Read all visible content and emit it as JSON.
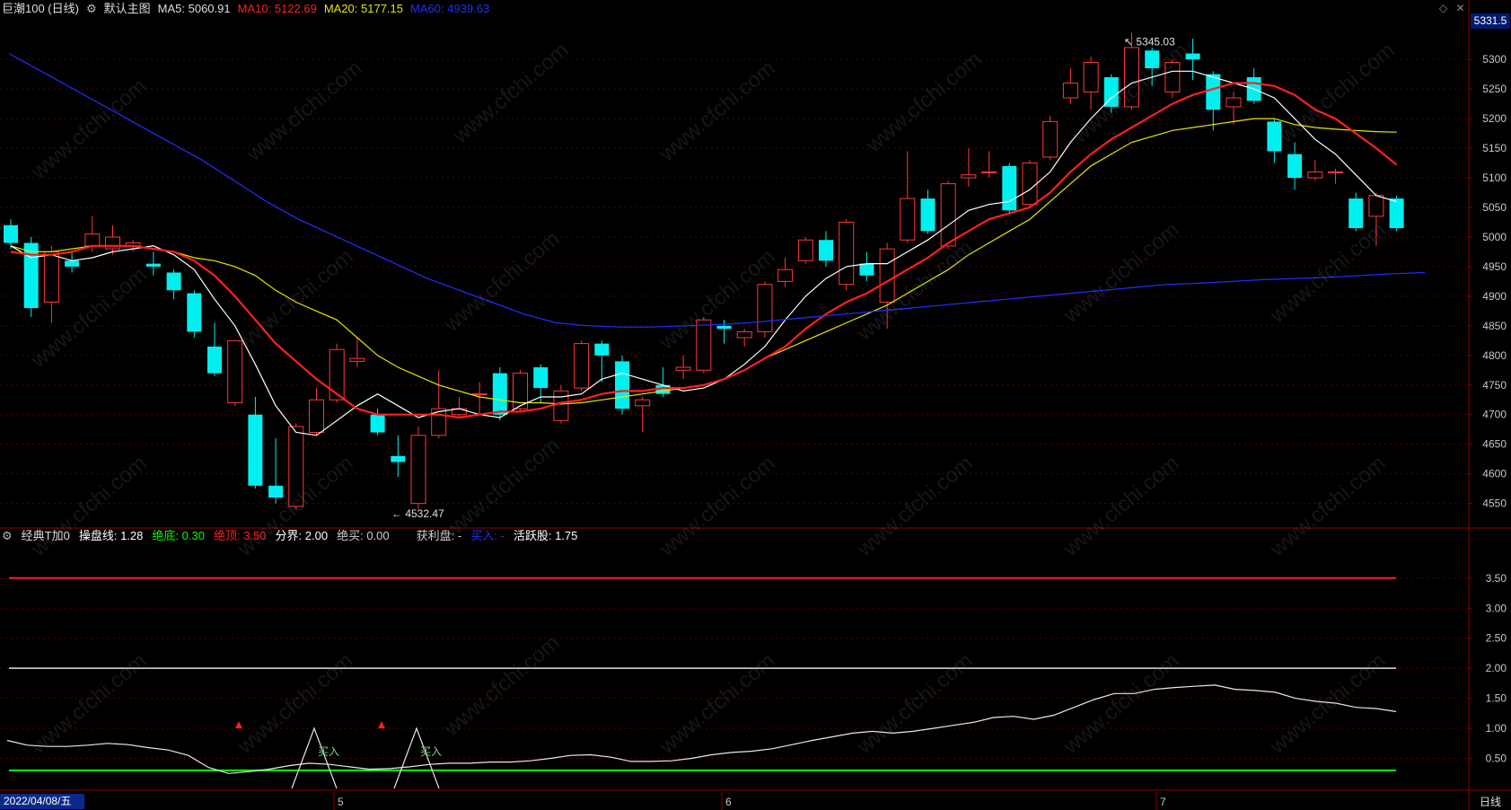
{
  "main": {
    "stock": "巨潮100 (日线)",
    "chart_name": "默认主图",
    "ma5": {
      "label": "MA5:",
      "value": "5060.91",
      "color": "#ffffff"
    },
    "ma10": {
      "label": "MA10:",
      "value": "5122.69",
      "color": "#ff2020"
    },
    "ma20": {
      "label": "MA20:",
      "value": "5177.15",
      "color": "#e6e600"
    },
    "ma60": {
      "label": "MA60:",
      "value": "4939.63",
      "color": "#2030ff"
    },
    "last_price": "5331.5",
    "high_label": "5345.03",
    "low_label": "4532.47",
    "y_ticks": [
      "5300",
      "5250",
      "5200",
      "5150",
      "5100",
      "5050",
      "5000",
      "4950",
      "4900",
      "4850",
      "4800",
      "4750",
      "4700",
      "4650",
      "4600",
      "4550"
    ]
  },
  "indicator": {
    "name": "经典T加0",
    "caopan": {
      "label": "操盘线:",
      "value": "1.28",
      "color": "#ffffff"
    },
    "juedi": {
      "label": "绝底:",
      "value": "0.30",
      "color": "#00ff00"
    },
    "jueding": {
      "label": "绝顶:",
      "value": "3.50",
      "color": "#ff2020"
    },
    "fenjie": {
      "label": "分界:",
      "value": "2.00",
      "color": "#ffffff"
    },
    "juemai": {
      "label": "绝买:",
      "value": "0.00",
      "color": "#ffffff"
    },
    "huolipan": {
      "label": "获利盘:",
      "value": "-",
      "color": "#ffffff"
    },
    "mairu": {
      "label": "买入:",
      "value": "-",
      "color": "#2030ff"
    },
    "huoyue": {
      "label": "活跃股:",
      "value": "1.75",
      "color": "#ffffff"
    },
    "buy_text": "买入",
    "y_ticks": [
      "3.50",
      "3.00",
      "2.50",
      "2.00",
      "1.50",
      "1.00",
      "0.50"
    ]
  },
  "x_axis": {
    "date": "2022/04/08/五",
    "months": [
      "5",
      "6",
      "7"
    ],
    "period": "日线"
  },
  "watermark": "www.cfchi.com",
  "candles": [
    {
      "o": 5020,
      "c": 4990,
      "h": 5030,
      "l": 4980
    },
    {
      "o": 4990,
      "c": 4880,
      "h": 5000,
      "l": 4865
    },
    {
      "o": 4890,
      "c": 4975,
      "h": 4985,
      "l": 4855
    },
    {
      "o": 4960,
      "c": 4950,
      "h": 4975,
      "l": 4940
    },
    {
      "o": 4985,
      "c": 5005,
      "h": 5035,
      "l": 4975
    },
    {
      "o": 4980,
      "c": 5000,
      "h": 5020,
      "l": 4970
    },
    {
      "o": 4985,
      "c": 4990,
      "h": 4995,
      "l": 4975
    },
    {
      "o": 4955,
      "c": 4950,
      "h": 4975,
      "l": 4935
    },
    {
      "o": 4940,
      "c": 4910,
      "h": 4945,
      "l": 4895
    },
    {
      "o": 4905,
      "c": 4840,
      "h": 4910,
      "l": 4830
    },
    {
      "o": 4815,
      "c": 4770,
      "h": 4855,
      "l": 4765
    },
    {
      "o": 4720,
      "c": 4825,
      "h": 4825,
      "l": 4715
    },
    {
      "o": 4700,
      "c": 4580,
      "h": 4730,
      "l": 4575
    },
    {
      "o": 4580,
      "c": 4560,
      "h": 4660,
      "l": 4550
    },
    {
      "o": 4545,
      "c": 4680,
      "h": 4685,
      "l": 4540
    },
    {
      "o": 4670,
      "c": 4725,
      "h": 4745,
      "l": 4665
    },
    {
      "o": 4725,
      "c": 4810,
      "h": 4820,
      "l": 4720
    },
    {
      "o": 4790,
      "c": 4795,
      "h": 4830,
      "l": 4780
    },
    {
      "o": 4700,
      "c": 4670,
      "h": 4710,
      "l": 4665
    },
    {
      "o": 4630,
      "c": 4620,
      "h": 4665,
      "l": 4595
    },
    {
      "o": 4550,
      "c": 4665,
      "h": 4680,
      "l": 4540
    },
    {
      "o": 4665,
      "c": 4710,
      "h": 4775,
      "l": 4660
    },
    {
      "o": 4700,
      "c": 4710,
      "h": 4730,
      "l": 4695
    },
    {
      "o": 4735,
      "c": 4735,
      "h": 4755,
      "l": 4700
    },
    {
      "o": 4770,
      "c": 4700,
      "h": 4780,
      "l": 4690
    },
    {
      "o": 4710,
      "c": 4770,
      "h": 4775,
      "l": 4705
    },
    {
      "o": 4780,
      "c": 4745,
      "h": 4785,
      "l": 4720
    },
    {
      "o": 4690,
      "c": 4740,
      "h": 4750,
      "l": 4685
    },
    {
      "o": 4745,
      "c": 4820,
      "h": 4825,
      "l": 4740
    },
    {
      "o": 4820,
      "c": 4800,
      "h": 4825,
      "l": 4755
    },
    {
      "o": 4790,
      "c": 4710,
      "h": 4800,
      "l": 4700
    },
    {
      "o": 4715,
      "c": 4725,
      "h": 4730,
      "l": 4670
    },
    {
      "o": 4750,
      "c": 4735,
      "h": 4780,
      "l": 4730
    },
    {
      "o": 4775,
      "c": 4780,
      "h": 4800,
      "l": 4760
    },
    {
      "o": 4775,
      "c": 4860,
      "h": 4865,
      "l": 4770
    },
    {
      "o": 4850,
      "c": 4845,
      "h": 4860,
      "l": 4820
    },
    {
      "o": 4830,
      "c": 4840,
      "h": 4845,
      "l": 4815
    },
    {
      "o": 4840,
      "c": 4920,
      "h": 4925,
      "l": 4830
    },
    {
      "o": 4925,
      "c": 4945,
      "h": 4965,
      "l": 4915
    },
    {
      "o": 4960,
      "c": 4995,
      "h": 5000,
      "l": 4955
    },
    {
      "o": 4995,
      "c": 4960,
      "h": 5010,
      "l": 4950
    },
    {
      "o": 4920,
      "c": 5025,
      "h": 5030,
      "l": 4910
    },
    {
      "o": 4955,
      "c": 4935,
      "h": 4975,
      "l": 4925
    },
    {
      "o": 4890,
      "c": 4980,
      "h": 4990,
      "l": 4845
    },
    {
      "o": 4995,
      "c": 5065,
      "h": 5145,
      "l": 4990
    },
    {
      "o": 5065,
      "c": 5010,
      "h": 5080,
      "l": 5005
    },
    {
      "o": 4985,
      "c": 5090,
      "h": 5095,
      "l": 4980
    },
    {
      "o": 5100,
      "c": 5105,
      "h": 5150,
      "l": 5085
    },
    {
      "o": 5110,
      "c": 5110,
      "h": 5145,
      "l": 5100
    },
    {
      "o": 5120,
      "c": 5045,
      "h": 5125,
      "l": 5040
    },
    {
      "o": 5055,
      "c": 5125,
      "h": 5130,
      "l": 5050
    },
    {
      "o": 5135,
      "c": 5195,
      "h": 5205,
      "l": 5130
    },
    {
      "o": 5235,
      "c": 5260,
      "h": 5285,
      "l": 5225
    },
    {
      "o": 5245,
      "c": 5295,
      "h": 5305,
      "l": 5215
    },
    {
      "o": 5270,
      "c": 5220,
      "h": 5275,
      "l": 5210
    },
    {
      "o": 5220,
      "c": 5320,
      "h": 5345,
      "l": 5215
    },
    {
      "o": 5315,
      "c": 5285,
      "h": 5320,
      "l": 5255
    },
    {
      "o": 5245,
      "c": 5295,
      "h": 5300,
      "l": 5235
    },
    {
      "o": 5310,
      "c": 5300,
      "h": 5335,
      "l": 5265
    },
    {
      "o": 5275,
      "c": 5215,
      "h": 5280,
      "l": 5180
    },
    {
      "o": 5220,
      "c": 5235,
      "h": 5245,
      "l": 5190
    },
    {
      "o": 5270,
      "c": 5230,
      "h": 5285,
      "l": 5225
    },
    {
      "o": 5195,
      "c": 5145,
      "h": 5200,
      "l": 5125
    },
    {
      "o": 5140,
      "c": 5100,
      "h": 5160,
      "l": 5080
    },
    {
      "o": 5100,
      "c": 5110,
      "h": 5130,
      "l": 5095
    },
    {
      "o": 5110,
      "c": 5110,
      "h": 5115,
      "l": 5090
    },
    {
      "o": 5065,
      "c": 5015,
      "h": 5075,
      "l": 5010
    },
    {
      "o": 5035,
      "c": 5070,
      "h": 5075,
      "l": 4985
    },
    {
      "o": 5065,
      "c": 5015,
      "h": 5070,
      "l": 5010
    }
  ],
  "ma5_line": [
    4985,
    4965,
    4970,
    4960,
    4965,
    4975,
    4980,
    4985,
    4970,
    4945,
    4895,
    4850,
    4785,
    4715,
    4670,
    4665,
    4690,
    4715,
    4735,
    4715,
    4695,
    4705,
    4710,
    4700,
    4695,
    4715,
    4730,
    4730,
    4735,
    4760,
    4770,
    4760,
    4750,
    4740,
    4745,
    4760,
    4785,
    4815,
    4860,
    4900,
    4930,
    4950,
    4955,
    4955,
    4975,
    4995,
    5020,
    5045,
    5055,
    5060,
    5080,
    5110,
    5160,
    5200,
    5235,
    5260,
    5270,
    5280,
    5280,
    5270,
    5260,
    5250,
    5235,
    5200,
    5165,
    5140,
    5105,
    5070,
    5060
  ],
  "ma10_line": [
    4975,
    4970,
    4970,
    4975,
    4985,
    4985,
    4985,
    4980,
    4975,
    4960,
    4935,
    4900,
    4860,
    4820,
    4790,
    4760,
    4735,
    4710,
    4700,
    4700,
    4700,
    4700,
    4695,
    4700,
    4705,
    4705,
    4710,
    4720,
    4725,
    4735,
    4740,
    4740,
    4745,
    4745,
    4750,
    4760,
    4775,
    4795,
    4815,
    4845,
    4870,
    4890,
    4905,
    4925,
    4945,
    4965,
    4990,
    5010,
    5030,
    5040,
    5050,
    5075,
    5110,
    5140,
    5165,
    5185,
    5205,
    5225,
    5240,
    5250,
    5260,
    5260,
    5255,
    5240,
    5215,
    5200,
    5175,
    5150,
    5122
  ],
  "ma20_line": [
    4985,
    4975,
    4975,
    4980,
    4985,
    4985,
    4985,
    4980,
    4975,
    4965,
    4960,
    4950,
    4935,
    4910,
    4890,
    4875,
    4860,
    4830,
    4800,
    4780,
    4765,
    4750,
    4740,
    4730,
    4725,
    4720,
    4720,
    4718,
    4720,
    4725,
    4730,
    4735,
    4740,
    4745,
    4750,
    4760,
    4775,
    4795,
    4810,
    4825,
    4840,
    4855,
    4870,
    4885,
    4905,
    4925,
    4945,
    4970,
    4990,
    5010,
    5030,
    5060,
    5090,
    5120,
    5140,
    5160,
    5170,
    5180,
    5185,
    5190,
    5195,
    5200,
    5200,
    5190,
    5185,
    5182,
    5180,
    5178,
    5177
  ],
  "ma60_line": [
    5310,
    5280,
    5250,
    5220,
    5190,
    5160,
    5130,
    5095,
    5060,
    5030,
    5005,
    4980,
    4955,
    4930,
    4910,
    4890,
    4870,
    4855,
    4850,
    4848,
    4848,
    4850,
    4852,
    4855,
    4860,
    4865,
    4870,
    4875,
    4880,
    4885,
    4890,
    4895,
    4900,
    4905,
    4910,
    4915,
    4920,
    4922,
    4925,
    4928,
    4930,
    4932,
    4935,
    4938,
    4940
  ],
  "ind_line": [
    0.8,
    0.72,
    0.7,
    0.7,
    0.72,
    0.75,
    0.73,
    0.68,
    0.64,
    0.55,
    0.35,
    0.25,
    0.28,
    0.32,
    0.38,
    0.42,
    0.4,
    0.36,
    0.32,
    0.33,
    0.36,
    0.4,
    0.42,
    0.42,
    0.44,
    0.44,
    0.46,
    0.5,
    0.55,
    0.56,
    0.52,
    0.45,
    0.45,
    0.46,
    0.5,
    0.56,
    0.6,
    0.62,
    0.66,
    0.73,
    0.8,
    0.86,
    0.92,
    0.95,
    0.92,
    0.95,
    1.0,
    1.05,
    1.1,
    1.18,
    1.2,
    1.15,
    1.22,
    1.35,
    1.48,
    1.58,
    1.58,
    1.65,
    1.68,
    1.7,
    1.72,
    1.65,
    1.63,
    1.6,
    1.5,
    1.45,
    1.42,
    1.35,
    1.33,
    1.28
  ]
}
